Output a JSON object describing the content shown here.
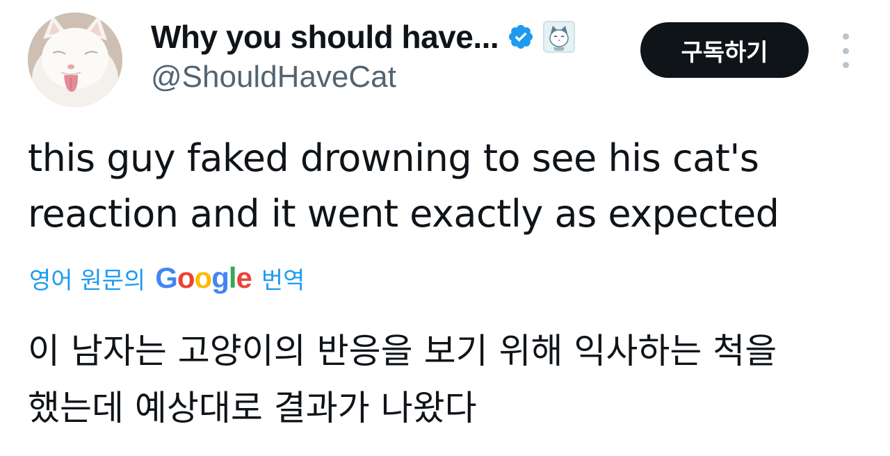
{
  "author": {
    "display_name": "Why you should have...",
    "handle": "@ShouldHaveCat",
    "avatar_icon": "white-cat-avatar",
    "verified_icon": "verified-badge-icon",
    "affiliate_icon": "cat-affiliate-badge-icon"
  },
  "actions": {
    "subscribe_label": "구독하기",
    "more_icon": "more-vertical-icon"
  },
  "tweet": {
    "text_lines": [
      "this guy faked drowning to see his cat's",
      "reaction and it went exactly as expected"
    ]
  },
  "translation": {
    "prefix": "영어 원문의",
    "brand_letters": [
      "G",
      "o",
      "o",
      "g",
      "l",
      "e"
    ],
    "suffix": "번역",
    "text_lines": [
      "이 남자는 고양이의 반응을 보기 위해 익사하는 척을",
      "했는데 예상대로 결과가 나왔다"
    ]
  },
  "colors": {
    "link": "#1d9bf0",
    "text": "#0f1419",
    "secondary": "#536471",
    "button_bg": "#0f1419",
    "verified": "#1d9bf0"
  }
}
